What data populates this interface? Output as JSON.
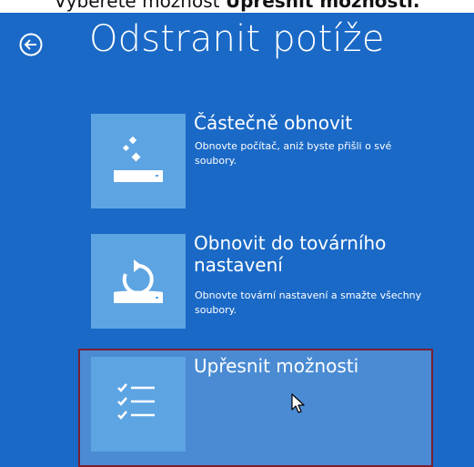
{
  "caption": {
    "normal": "Vyberete možnost ",
    "bold": "Upřesnit možnosti."
  },
  "header": {
    "back_icon": "arrow-left-circle-icon",
    "title": "Odstranit potíže"
  },
  "options": [
    {
      "id": "refresh",
      "icon": "refresh-sparkle-drive-icon",
      "title": "Částečně obnovit",
      "description": "Obnovte počítač, aniž byste přišli o své soubory."
    },
    {
      "id": "reset",
      "icon": "reset-circular-arrow-drive-icon",
      "title": "Obnovit do továrního nastavení",
      "description": "Obnovte tovární nastavení a smažte všechny soubory."
    },
    {
      "id": "advanced",
      "icon": "checklist-icon",
      "title": "Upřesnit možnosti",
      "selected": true
    }
  ],
  "colors": {
    "background": "#1a69c6",
    "tile": "#5da4e2",
    "selected_fill": "#4a8bd3",
    "selected_border": "#7a1f33",
    "text": "#ffffff"
  }
}
